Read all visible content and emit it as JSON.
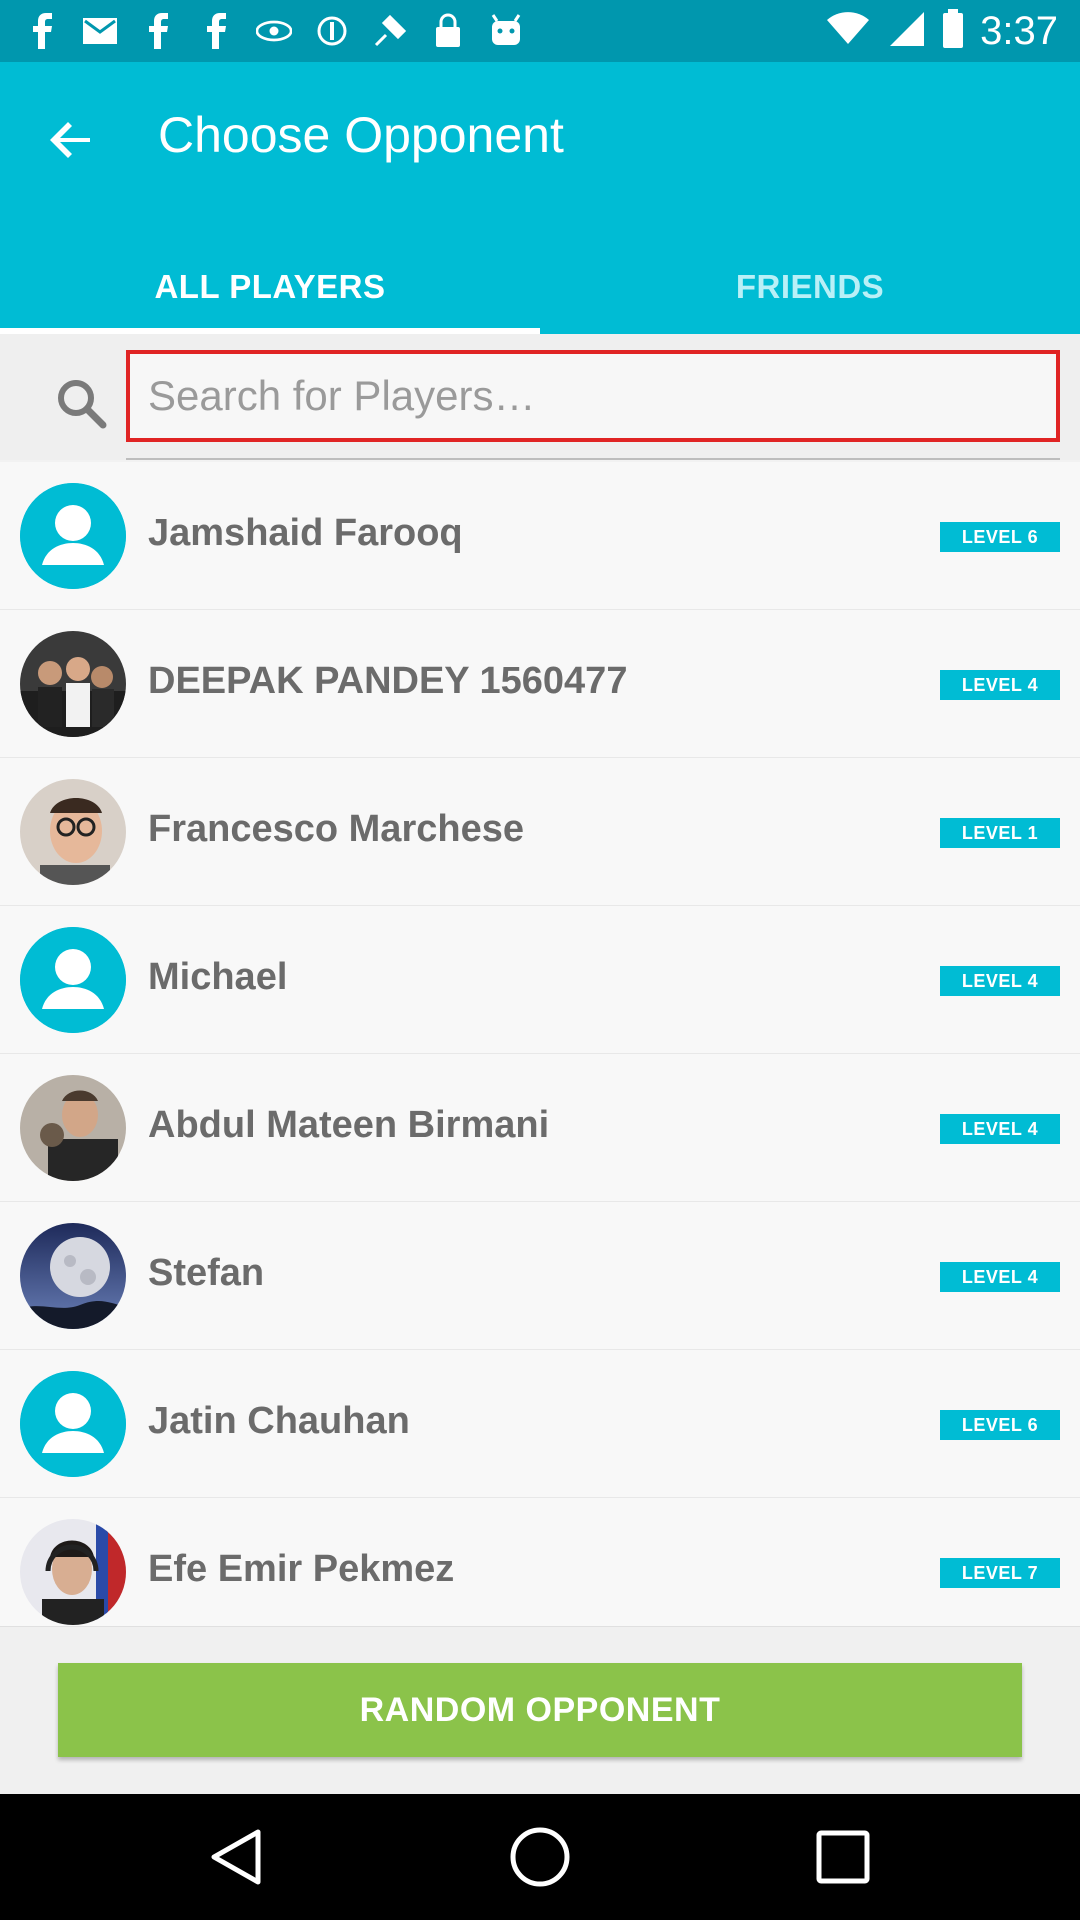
{
  "status_bar": {
    "time": "3:37",
    "icons": [
      "facebook-icon",
      "mail-icon",
      "facebook-icon",
      "facebook-icon",
      "eye-icon",
      "sync-icon",
      "satellite-icon",
      "lock-icon",
      "android-icon"
    ]
  },
  "header": {
    "title": "Choose Opponent",
    "tabs": [
      {
        "label": "ALL PLAYERS",
        "active": true
      },
      {
        "label": "FRIENDS",
        "active": false
      }
    ]
  },
  "search": {
    "placeholder": "Search for Players…",
    "value": ""
  },
  "players": [
    {
      "name": "Jamshaid Farooq",
      "level": "LEVEL 6",
      "avatar": "default-avatar"
    },
    {
      "name": "DEEPAK PANDEY 1560477",
      "level": "LEVEL 4",
      "avatar": "group-photo"
    },
    {
      "name": "Francesco Marchese",
      "level": "LEVEL 1",
      "avatar": "selfie-photo"
    },
    {
      "name": "Michael",
      "level": "LEVEL 4",
      "avatar": "default-avatar"
    },
    {
      "name": "Abdul Mateen Birmani",
      "level": "LEVEL 4",
      "avatar": "portrait-photo"
    },
    {
      "name": "Stefan",
      "level": "LEVEL 4",
      "avatar": "moon-photo"
    },
    {
      "name": "Jatin Chauhan",
      "level": "LEVEL 6",
      "avatar": "default-avatar"
    },
    {
      "name": "Efe Emir Pekmez",
      "level": "LEVEL 7",
      "avatar": "headphones-photo"
    }
  ],
  "random_button": {
    "label": "RANDOM OPPONENT"
  },
  "colors": {
    "accent": "#00bcd4",
    "status_bar": "#0097ae",
    "button": "#8bc34a",
    "search_border": "#e02424"
  }
}
